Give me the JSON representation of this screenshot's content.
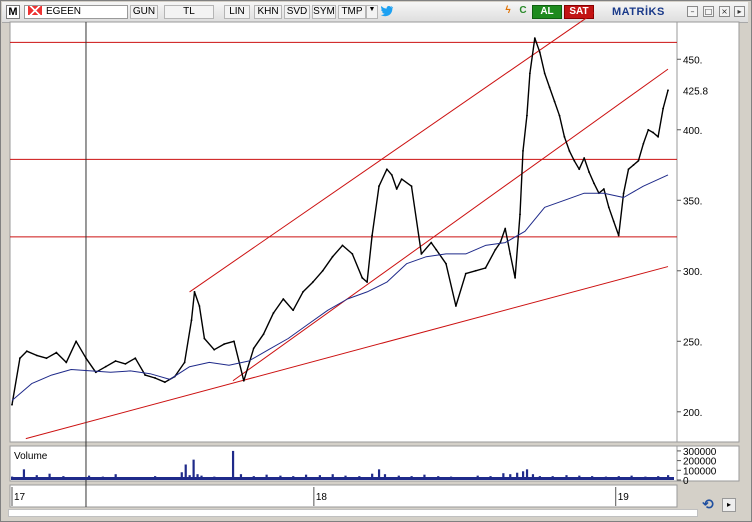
{
  "toolbar": {
    "logo": "M",
    "symbol": "EGEEN",
    "period": "GUN",
    "currency": "TL",
    "scale": "LIN",
    "buttons": [
      "KHN",
      "SVD",
      "SYM",
      "TMP"
    ],
    "dropdown_icon": "▼",
    "twitter_icon": "twitter-icon",
    "buy_label": "AL",
    "sell_label": "SAT",
    "brand": "MATRİKS",
    "win_min": "–",
    "win_max": "□",
    "win_close": "×"
  },
  "colors": {
    "price": "#000000",
    "moving_average": "#1f2a8a",
    "trendlines": "#cc1111",
    "volume": "#1f2a8a",
    "buy": "#1e8a1e",
    "sell": "#c21414"
  },
  "chart_data": [
    {
      "type": "line",
      "x_ticks": [
        "17",
        "18",
        "19"
      ],
      "y_ticks": [
        "200.",
        "250.",
        "300.",
        "350.",
        "400.",
        "450."
      ],
      "last_price_label": "425.8",
      "ylim": [
        180,
        475
      ],
      "series": [
        {
          "key": "price",
          "x": [
            0,
            8,
            15,
            25,
            35,
            45,
            55,
            65,
            75,
            85,
            95,
            105,
            115,
            125,
            135,
            145,
            155,
            165,
            175,
            182,
            185,
            190,
            195,
            205,
            215,
            225,
            235,
            245,
            255,
            265,
            275,
            285,
            295,
            305,
            315,
            325,
            335,
            345,
            355,
            360,
            365,
            372,
            380,
            385,
            390,
            395,
            405,
            415,
            425,
            430,
            440,
            450,
            460,
            470,
            480,
            490,
            495,
            500,
            505,
            510,
            515,
            518,
            522,
            525,
            530,
            535,
            540,
            545,
            550,
            555,
            560,
            565,
            570,
            575,
            580,
            585,
            590,
            595,
            600,
            605,
            610,
            615,
            620,
            625,
            630,
            635,
            640,
            645,
            650,
            655,
            660,
            665
          ],
          "values": [
            205,
            238,
            243,
            240,
            238,
            242,
            235,
            250,
            238,
            228,
            232,
            236,
            234,
            238,
            226,
            224,
            221,
            225,
            235,
            265,
            285,
            275,
            252,
            244,
            248,
            250,
            222,
            245,
            255,
            270,
            280,
            272,
            285,
            292,
            300,
            310,
            318,
            312,
            295,
            292,
            325,
            360,
            372,
            368,
            358,
            365,
            360,
            312,
            320,
            315,
            305,
            275,
            298,
            300,
            302,
            315,
            320,
            330,
            312,
            295,
            340,
            385,
            410,
            440,
            465,
            455,
            440,
            430,
            420,
            410,
            395,
            385,
            378,
            372,
            380,
            370,
            362,
            355,
            358,
            345,
            335,
            325,
            355,
            372,
            375,
            378,
            390,
            400,
            398,
            395,
            415,
            428
          ]
        },
        {
          "key": "moving_average",
          "x": [
            0,
            20,
            40,
            60,
            80,
            100,
            120,
            140,
            160,
            180,
            200,
            220,
            240,
            260,
            280,
            300,
            320,
            340,
            360,
            380,
            400,
            420,
            440,
            460,
            480,
            500,
            520,
            540,
            560,
            580,
            600,
            620,
            640,
            665
          ],
          "values": [
            208,
            220,
            226,
            230,
            229,
            228,
            229,
            227,
            223,
            232,
            235,
            233,
            236,
            244,
            252,
            262,
            272,
            280,
            285,
            292,
            305,
            310,
            312,
            312,
            318,
            320,
            328,
            345,
            350,
            355,
            355,
            352,
            360,
            368
          ]
        }
      ],
      "horizontal_lines": [
        462,
        379,
        324
      ],
      "trendlines": [
        {
          "from": [
            14,
            181
          ],
          "to": [
            665,
            303
          ]
        },
        {
          "from": [
            180,
            285
          ],
          "to": [
            590,
            483
          ]
        },
        {
          "from": [
            224,
            222
          ],
          "to": [
            665,
            443
          ]
        }
      ],
      "crosshair_x": 75
    },
    {
      "type": "bar",
      "title": "Volume",
      "y_ticks": [
        "300000",
        "200000",
        "100000",
        "0"
      ],
      "ylim": [
        0,
        330000
      ],
      "x": [
        0,
        12,
        25,
        38,
        52,
        65,
        78,
        92,
        105,
        118,
        132,
        145,
        158,
        172,
        176,
        180,
        184,
        188,
        192,
        205,
        218,
        224,
        232,
        245,
        258,
        272,
        285,
        298,
        312,
        325,
        338,
        352,
        365,
        372,
        378,
        392,
        405,
        418,
        432,
        445,
        458,
        472,
        485,
        498,
        505,
        512,
        518,
        522,
        528,
        535,
        548,
        562,
        575,
        588,
        602,
        615,
        628,
        642,
        655,
        665
      ],
      "values": [
        35000,
        110000,
        50000,
        65000,
        40000,
        30000,
        45000,
        35000,
        60000,
        25000,
        30000,
        40000,
        30000,
        80000,
        160000,
        50000,
        210000,
        60000,
        45000,
        35000,
        30000,
        300000,
        60000,
        40000,
        55000,
        45000,
        40000,
        55000,
        50000,
        60000,
        45000,
        40000,
        65000,
        110000,
        60000,
        45000,
        40000,
        55000,
        40000,
        35000,
        30000,
        45000,
        40000,
        70000,
        60000,
        75000,
        90000,
        110000,
        60000,
        40000,
        40000,
        50000,
        45000,
        40000,
        35000,
        40000,
        45000,
        35000,
        40000,
        50000
      ]
    }
  ]
}
